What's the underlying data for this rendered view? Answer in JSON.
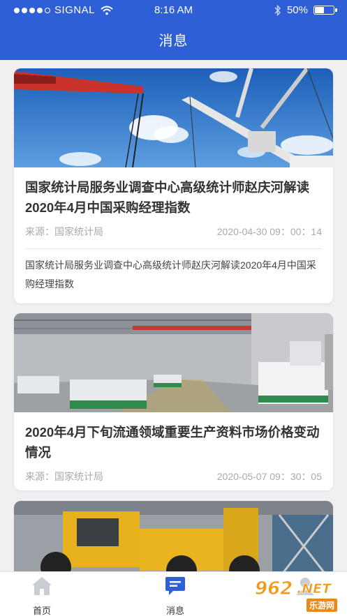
{
  "status_bar": {
    "carrier": "SIGNAL",
    "time": "8:16 AM",
    "battery": "50%"
  },
  "header": {
    "title": "消息"
  },
  "articles": [
    {
      "title": "国家统计局服务业调查中心高级统计师赵庆河解读2020年4月中国采购经理指数",
      "source": "来源：国家统计局",
      "date": "2020-04-30  09：00：14",
      "summary": "国家统计局服务业调查中心高级统计师赵庆河解读2020年4月中国采购经理指数",
      "image": "cranes-sky"
    },
    {
      "title": "2020年4月下旬流通领域重要生产资料市场价格变动情况",
      "source": "来源：国家统计局",
      "date": "2020-05-07  09：30：05",
      "image": "factory-floor"
    },
    {
      "image": "yellow-loaders"
    }
  ],
  "tabs": [
    {
      "label": "首页",
      "icon": "home-icon"
    },
    {
      "label": "消息",
      "icon": "message-icon"
    }
  ],
  "colors": {
    "header_bg": "#2f5fd6",
    "tab_inactive": "#c9ccd2",
    "tab_active": "#2f5fd6"
  },
  "watermark": {
    "logo": "962.NET",
    "sub": "乐游网"
  }
}
